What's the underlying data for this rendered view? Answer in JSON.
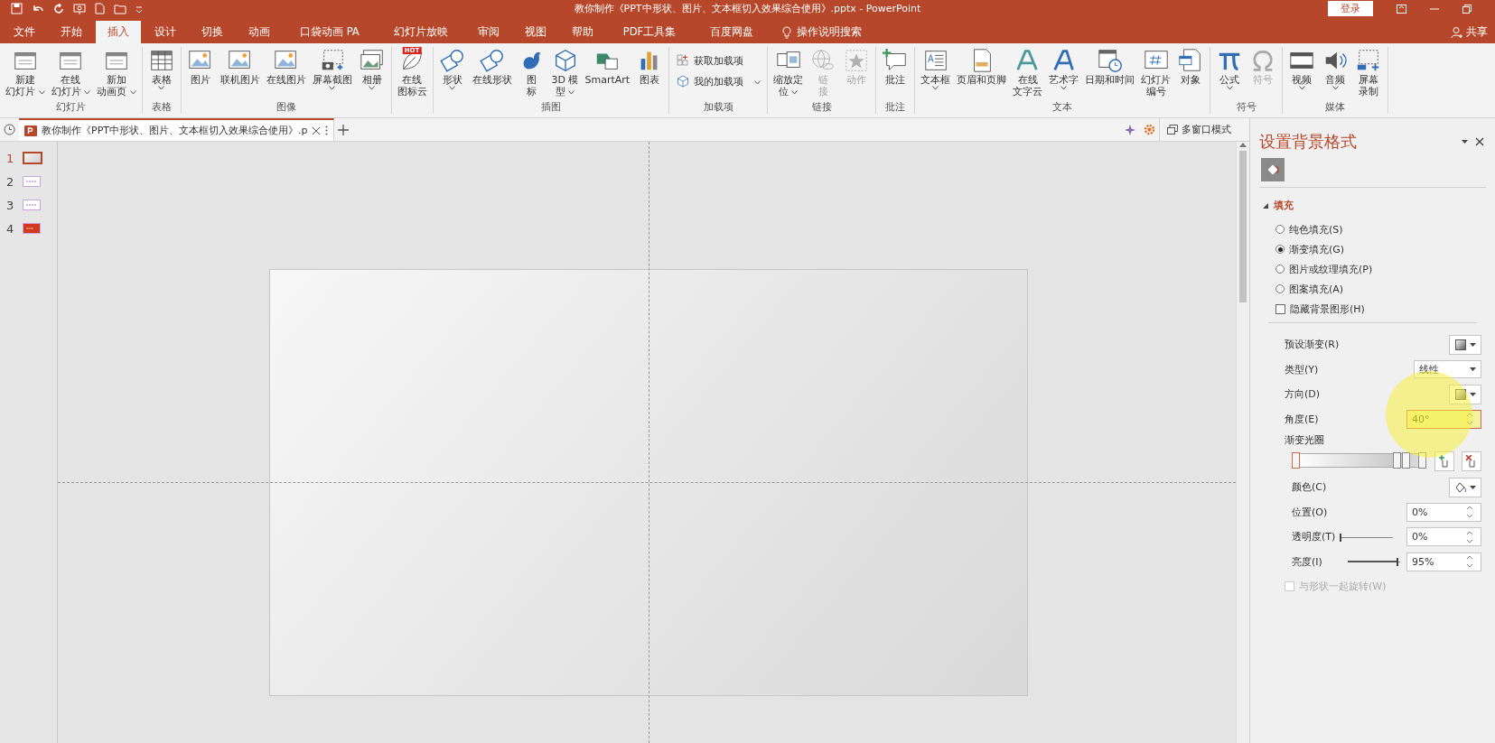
{
  "title_bar": {
    "title": "教你制作《PPT中形状、图片、文本框切入效果综合使用》.pptx  -  PowerPoint",
    "login_button": "登录"
  },
  "menu_tabs": [
    {
      "label": "文件",
      "selected": false
    },
    {
      "label": "开始",
      "selected": false
    },
    {
      "label": "插入",
      "selected": true
    },
    {
      "label": "设计",
      "selected": false
    },
    {
      "label": "切换",
      "selected": false
    },
    {
      "label": "动画",
      "selected": false
    },
    {
      "label": "口袋动画 PA",
      "selected": false
    },
    {
      "label": "幻灯片放映",
      "selected": false
    },
    {
      "label": "审阅",
      "selected": false
    },
    {
      "label": "视图",
      "selected": false
    },
    {
      "label": "帮助",
      "selected": false
    },
    {
      "label": "PDF工具集",
      "selected": false
    },
    {
      "label": "百度网盘",
      "selected": false
    }
  ],
  "tell_me": "操作说明搜索",
  "share": "共享",
  "ribbon_groups": [
    {
      "label": "幻灯片",
      "kind": "large",
      "commands": [
        {
          "lines": [
            "新建",
            "幻灯片"
          ],
          "dropdown": true,
          "disabled": false
        },
        {
          "lines": [
            "在线",
            "幻灯片"
          ],
          "dropdown": true,
          "disabled": false
        },
        {
          "lines": [
            "新加",
            "动画页"
          ],
          "dropdown": true,
          "disabled": false
        }
      ]
    },
    {
      "label": "表格",
      "kind": "large",
      "commands": [
        {
          "lines": [
            "表格"
          ],
          "dropdown": true,
          "disabled": false
        }
      ]
    },
    {
      "label": "图像",
      "kind": "large",
      "commands": [
        {
          "lines": [
            "图片"
          ],
          "dropdown": false,
          "disabled": false
        },
        {
          "lines": [
            "联机图片"
          ],
          "dropdown": false,
          "disabled": false
        },
        {
          "lines": [
            "在线图片"
          ],
          "dropdown": false,
          "disabled": false
        },
        {
          "lines": [
            "屏幕截图"
          ],
          "dropdown": true,
          "disabled": false
        },
        {
          "lines": [
            "相册"
          ],
          "dropdown": true,
          "disabled": false
        }
      ]
    },
    {
      "kind": "large",
      "commands": [
        {
          "lines": [
            "在线",
            "图标云"
          ],
          "dropdown": false,
          "disabled": false,
          "badge": "HOT"
        }
      ]
    },
    {
      "label": "插图",
      "kind": "large",
      "commands": [
        {
          "lines": [
            "形状"
          ],
          "dropdown": true,
          "disabled": false
        },
        {
          "lines": [
            "在线形状"
          ],
          "dropdown": false,
          "disabled": false
        },
        {
          "lines": [
            "图",
            "标"
          ],
          "dropdown": false,
          "disabled": false
        },
        {
          "lines": [
            "3D 模",
            "型"
          ],
          "dropdown": true,
          "disabled": false
        },
        {
          "lines": [
            "SmartArt"
          ],
          "dropdown": false,
          "disabled": false
        },
        {
          "lines": [
            "图表"
          ],
          "dropdown": false,
          "disabled": false
        }
      ]
    },
    {
      "label": "加载项",
      "kind": "small",
      "commands": [
        {
          "lines": [
            "获取加载项"
          ],
          "dropdown": false,
          "disabled": false
        },
        {
          "lines": [
            "我的加载项"
          ],
          "dropdown": true,
          "disabled": false
        }
      ]
    },
    {
      "label": "链接",
      "kind": "large",
      "commands": [
        {
          "lines": [
            "缩放定",
            "位"
          ],
          "dropdown": true,
          "disabled": false
        },
        {
          "lines": [
            "链",
            "接"
          ],
          "dropdown": false,
          "disabled": true
        },
        {
          "lines": [
            "动作"
          ],
          "dropdown": false,
          "disabled": true
        }
      ]
    },
    {
      "label": "批注",
      "kind": "large",
      "commands": [
        {
          "lines": [
            "批注"
          ],
          "dropdown": false,
          "disabled": false
        }
      ]
    },
    {
      "label": "文本",
      "kind": "large",
      "commands": [
        {
          "lines": [
            "文本框"
          ],
          "dropdown": true,
          "disabled": false
        },
        {
          "lines": [
            "页眉和页脚"
          ],
          "dropdown": false,
          "disabled": false
        },
        {
          "lines": [
            "在线",
            "文字云"
          ],
          "dropdown": false,
          "disabled": false
        },
        {
          "lines": [
            "艺术字"
          ],
          "dropdown": true,
          "disabled": false
        },
        {
          "lines": [
            "日期和时间"
          ],
          "dropdown": false,
          "disabled": false
        },
        {
          "lines": [
            "幻灯片",
            "编号"
          ],
          "dropdown": false,
          "disabled": false
        },
        {
          "lines": [
            "对象"
          ],
          "dropdown": false,
          "disabled": false
        }
      ]
    },
    {
      "label": "符号",
      "kind": "large",
      "commands": [
        {
          "lines": [
            "公式"
          ],
          "dropdown": true,
          "disabled": false
        },
        {
          "lines": [
            "符号"
          ],
          "dropdown": false,
          "disabled": true
        }
      ]
    },
    {
      "label": "媒体",
      "kind": "large",
      "commands": [
        {
          "lines": [
            "视频"
          ],
          "dropdown": true,
          "disabled": false
        },
        {
          "lines": [
            "音频"
          ],
          "dropdown": true,
          "disabled": false
        },
        {
          "lines": [
            "屏幕",
            "录制"
          ],
          "dropdown": false,
          "disabled": false
        }
      ]
    }
  ],
  "document_tab": {
    "title": "教你制作《PPT中形状、图片、文本框切入效果综合使用》.p",
    "selected": true
  },
  "multi_window": "多窗口模式",
  "slides": [
    {
      "number": "1",
      "selected": true,
      "kind": "gradient"
    },
    {
      "number": "2",
      "selected": false,
      "kind": "text"
    },
    {
      "number": "3",
      "selected": false,
      "kind": "text"
    },
    {
      "number": "4",
      "selected": false,
      "kind": "red"
    }
  ],
  "format_pane": {
    "title": "设置背景格式",
    "section": {
      "label": "填充",
      "expanded": true
    },
    "fill_options": [
      {
        "label": "纯色填充(S)",
        "selected": false
      },
      {
        "label": "渐变填充(G)",
        "selected": true
      },
      {
        "label": "图片或纹理填充(P)",
        "selected": false
      },
      {
        "label": "图案填充(A)",
        "selected": false
      }
    ],
    "hide_background": {
      "label": "隐藏背景图形(H)",
      "checked": false
    },
    "preset_gradient": {
      "label": "预设渐变(R)"
    },
    "type": {
      "label": "类型(Y)",
      "value": "线性"
    },
    "direction": {
      "label": "方向(D)"
    },
    "angle": {
      "label": "角度(E)",
      "value": "40°",
      "focused": true
    },
    "gradient_stops": {
      "label": "渐变光圈",
      "stops": [
        {
          "level": 0.0,
          "selected": true
        },
        {
          "level": 0.8,
          "selected": false
        },
        {
          "level": 0.87,
          "selected": false
        },
        {
          "level": 1.0,
          "selected": false
        }
      ]
    },
    "color": {
      "label": "颜色(C)"
    },
    "position": {
      "label": "位置(O)",
      "value": "0%"
    },
    "transparency": {
      "label": "透明度(T)",
      "level": 0.0,
      "value": "0%"
    },
    "brightness": {
      "label": "亮度(I)",
      "level": 0.95,
      "value": "95%"
    },
    "rotate_with_shape": {
      "label": "与形状一起旋转(W)",
      "checked": false,
      "disabled": true
    }
  }
}
